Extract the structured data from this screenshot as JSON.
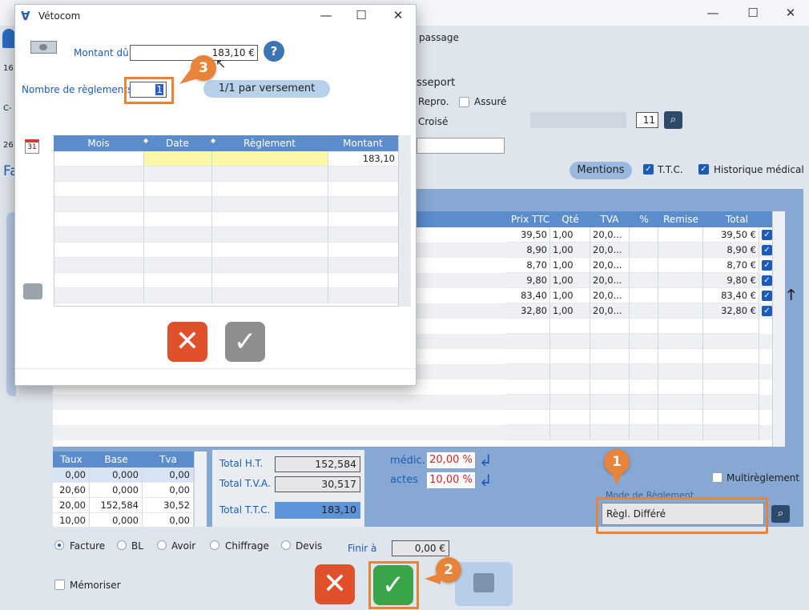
{
  "background": {
    "window_controls": [
      "—",
      "☐",
      "✕"
    ],
    "passage_label": "passage",
    "passeport_label": "sseport",
    "repro_label": "Repro.",
    "assure_label": "Assuré",
    "croise_label": "Croisé",
    "croise_number": "11",
    "mentions_button": "Mentions",
    "ttc_label": "T.T.C.",
    "historique_label": "Historique médical",
    "side_texts": [
      "16",
      "C-",
      "26",
      "Fa"
    ],
    "lines_table": {
      "headers": [
        "Prix TTC",
        "Qté",
        "TVA",
        "%",
        "Remise",
        "Total"
      ],
      "rows": [
        {
          "prix": "39,50",
          "qte": "1,00",
          "tva": "20,0...",
          "pct": "",
          "remise": "",
          "total": "39,50 €"
        },
        {
          "prix": "8,90",
          "qte": "1,00",
          "tva": "20,0...",
          "pct": "",
          "remise": "",
          "total": "8,90 €"
        },
        {
          "prix": "8,70",
          "qte": "1,00",
          "tva": "20,0...",
          "pct": "",
          "remise": "",
          "total": "8,70 €"
        },
        {
          "prix": "9,80",
          "qte": "1,00",
          "tva": "20,0...",
          "pct": "",
          "remise": "",
          "total": "9,80 €"
        },
        {
          "prix": "83,40",
          "qte": "1,00",
          "tva": "20,0...",
          "pct": "",
          "remise": "",
          "total": "83,40 €"
        },
        {
          "prix": "32,80",
          "qte": "1,00",
          "tva": "20,0...",
          "pct": "",
          "remise": "",
          "total": "32,80 €"
        }
      ]
    },
    "tva_table": {
      "headers": [
        "Taux",
        "Base",
        "Tva"
      ],
      "rows": [
        {
          "taux": "0,00",
          "base": "0,000",
          "tva": "0,00"
        },
        {
          "taux": "20,60",
          "base": "0,000",
          "tva": "0,00"
        },
        {
          "taux": "20,00",
          "base": "152,584",
          "tva": "30,52"
        },
        {
          "taux": "10,00",
          "base": "0,000",
          "tva": "0,00"
        }
      ]
    },
    "totals": {
      "ht_label": "Total H.T.",
      "ht_value": "152,584",
      "tva_label": "Total T.V.A.",
      "tva_value": "30,517",
      "ttc_label": "Total T.T.C.",
      "ttc_value": "183,10"
    },
    "remises": {
      "medic_label": "médic.",
      "medic_value": "20,00 %",
      "actes_label": "actes",
      "actes_value": "10,00 %"
    },
    "multireglement_label": "Multirèglement",
    "mode_reglement_label": "Mode de Règlement",
    "mode_reglement_value": "Règl. Différé",
    "doc_types": [
      "Facture",
      "BL",
      "Avoir",
      "Chiffrage",
      "Devis"
    ],
    "finir_label": "Finir à",
    "finir_value": "0,00 €",
    "memoriser_label": "Mémoriser"
  },
  "dialog": {
    "title": "Vétocom",
    "montant_label": "Montant dû",
    "montant_value": "183,10 €",
    "nombre_label": "Nombre de règlements",
    "nombre_value": "1",
    "versement_button": "1/1 par versement",
    "calendar_day": "31",
    "table": {
      "headers": [
        "Mois",
        "Date",
        "Règlement",
        "Montant"
      ],
      "rows": [
        {
          "mois": "",
          "date": "",
          "reglement": "",
          "montant": "183,10"
        }
      ]
    }
  },
  "callouts": [
    "1",
    "2",
    "3"
  ],
  "colors": {
    "accent_orange": "#e8843a",
    "header_blue": "#5b8ccb",
    "ok_green": "#3aa548",
    "cancel_red": "#e0502b"
  }
}
